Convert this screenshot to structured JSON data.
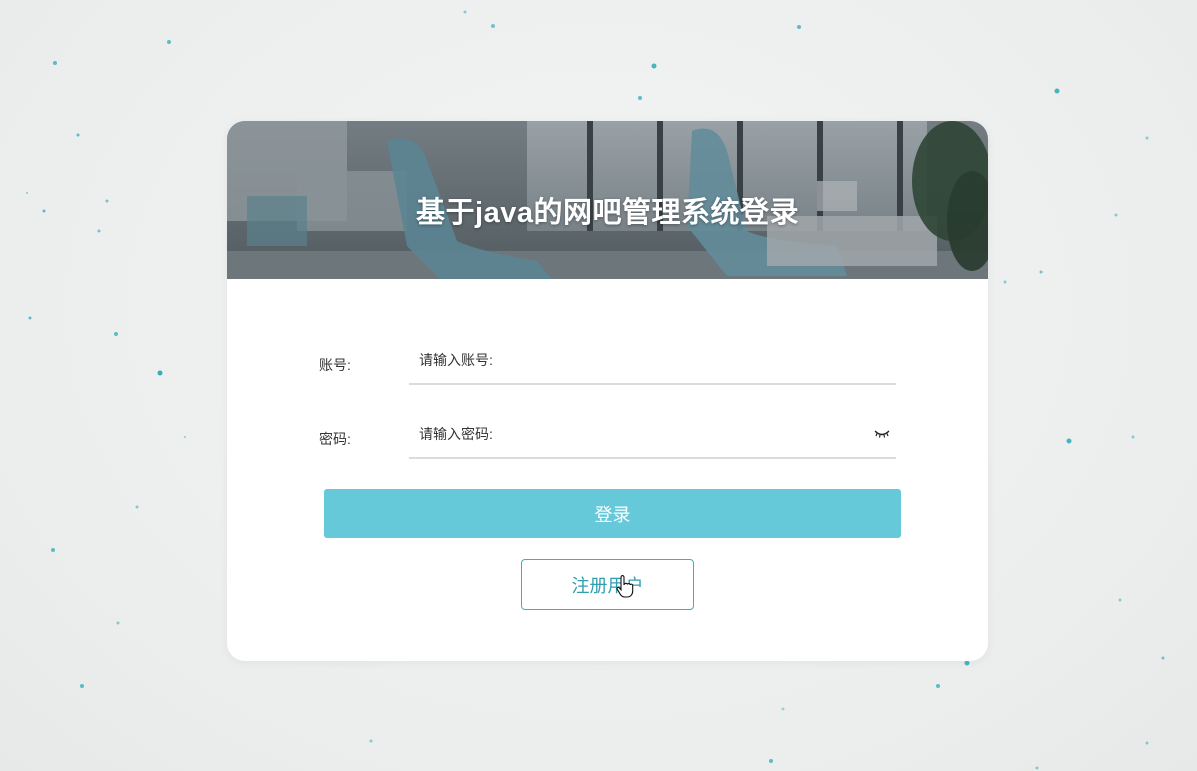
{
  "banner": {
    "title": "基于java的网吧管理系统登录"
  },
  "form": {
    "account": {
      "label": "账号:",
      "placeholder": "请输入账号:",
      "value": ""
    },
    "password": {
      "label": "密码:",
      "placeholder": "请输入密码:",
      "value": "",
      "toggle_icon": "eye-closed-icon"
    }
  },
  "actions": {
    "login_label": "登录",
    "register_label": "注册用户"
  },
  "colors": {
    "background": "#eef0f0",
    "login_button": "#65c9da",
    "register_border": "#3bb0bf",
    "register_text": "#2f9fae",
    "dot": "#1fa5b3"
  }
}
